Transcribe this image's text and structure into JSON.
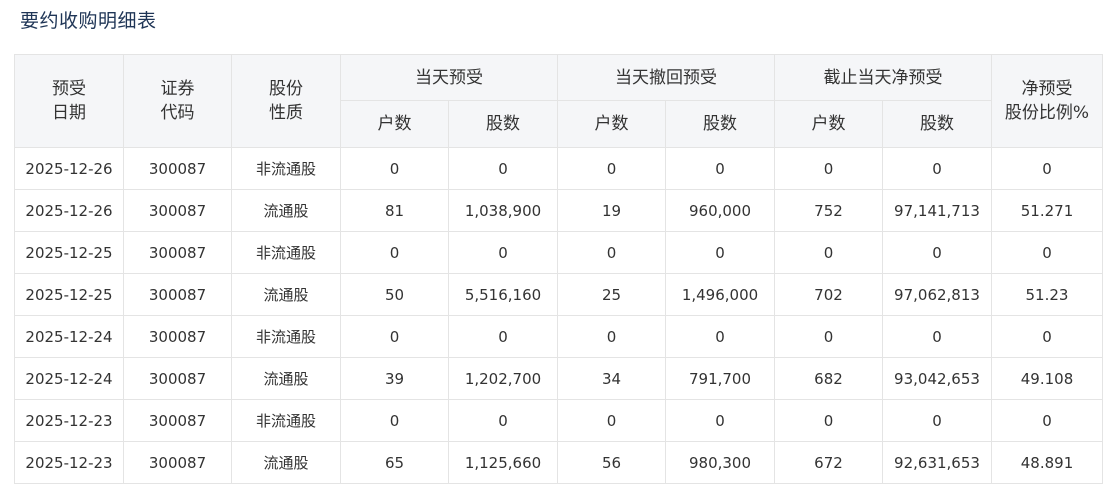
{
  "page_title": "要约收购明细表",
  "header": {
    "date": [
      "预受",
      "日期"
    ],
    "code": [
      "证券",
      "代码"
    ],
    "type": [
      "股份",
      "性质"
    ],
    "group_day": "当天预受",
    "group_withdraw": "当天撤回预受",
    "group_net": "截止当天净预受",
    "ratio": [
      "净预受",
      "股份比例%"
    ],
    "households": "户数",
    "shares": "股数"
  },
  "rows": [
    [
      "2025-12-26",
      "300087",
      "非流通股",
      "0",
      "0",
      "0",
      "0",
      "0",
      "0",
      "0"
    ],
    [
      "2025-12-26",
      "300087",
      "流通股",
      "81",
      "1,038,900",
      "19",
      "960,000",
      "752",
      "97,141,713",
      "51.271"
    ],
    [
      "2025-12-25",
      "300087",
      "非流通股",
      "0",
      "0",
      "0",
      "0",
      "0",
      "0",
      "0"
    ],
    [
      "2025-12-25",
      "300087",
      "流通股",
      "50",
      "5,516,160",
      "25",
      "1,496,000",
      "702",
      "97,062,813",
      "51.23"
    ],
    [
      "2025-12-24",
      "300087",
      "非流通股",
      "0",
      "0",
      "0",
      "0",
      "0",
      "0",
      "0"
    ],
    [
      "2025-12-24",
      "300087",
      "流通股",
      "39",
      "1,202,700",
      "34",
      "791,700",
      "682",
      "93,042,653",
      "49.108"
    ],
    [
      "2025-12-23",
      "300087",
      "非流通股",
      "0",
      "0",
      "0",
      "0",
      "0",
      "0",
      "0"
    ],
    [
      "2025-12-23",
      "300087",
      "流通股",
      "65",
      "1,125,660",
      "56",
      "980,300",
      "672",
      "92,631,653",
      "48.891"
    ]
  ]
}
